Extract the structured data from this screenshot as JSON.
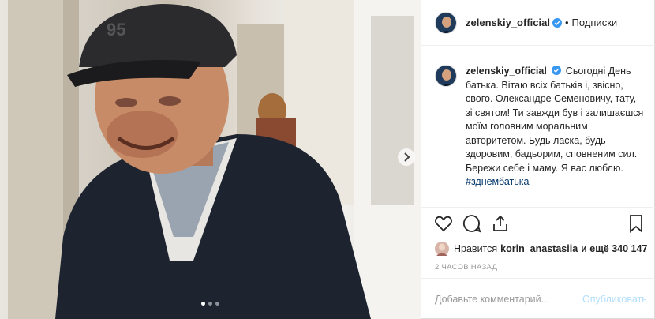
{
  "header": {
    "username": "zelenskiy_official",
    "separator": "•",
    "follow_label": "Подписки"
  },
  "caption": {
    "username": "zelenskiy_official",
    "text": "Сьогодні День батька. Вітаю всіх батьків і, звісно, свого. Олександре Семеновичу, тату, зі святом! Ти завжди був і залишаєшся моїм головним моральним авторитетом. Будь ласка, будь здоровим, бадьорим, сповненим сил. Бережи себе і маму. Я вас люблю.",
    "hashtag": "#зднембатька"
  },
  "likes": {
    "prefix": "Нравится",
    "user": "korin_anastasiia",
    "suffix": "и ещё 340 147"
  },
  "timestamp": "2 ЧАСОВ НАЗАД",
  "comment": {
    "placeholder": "Добавьте комментарий...",
    "publish_label": "Опубликовать"
  },
  "carousel": {
    "count": 3,
    "active": 1
  },
  "icons": {
    "like": "heart-icon",
    "comment": "comment-icon",
    "share": "share-icon",
    "save": "bookmark-icon",
    "verified": "verified-badge-icon",
    "next": "chevron-right-icon"
  },
  "colors": {
    "text": "#262626",
    "muted": "#999999",
    "hashtag": "#003569",
    "publish": "#b2dffc",
    "verified": "#3897f0"
  }
}
